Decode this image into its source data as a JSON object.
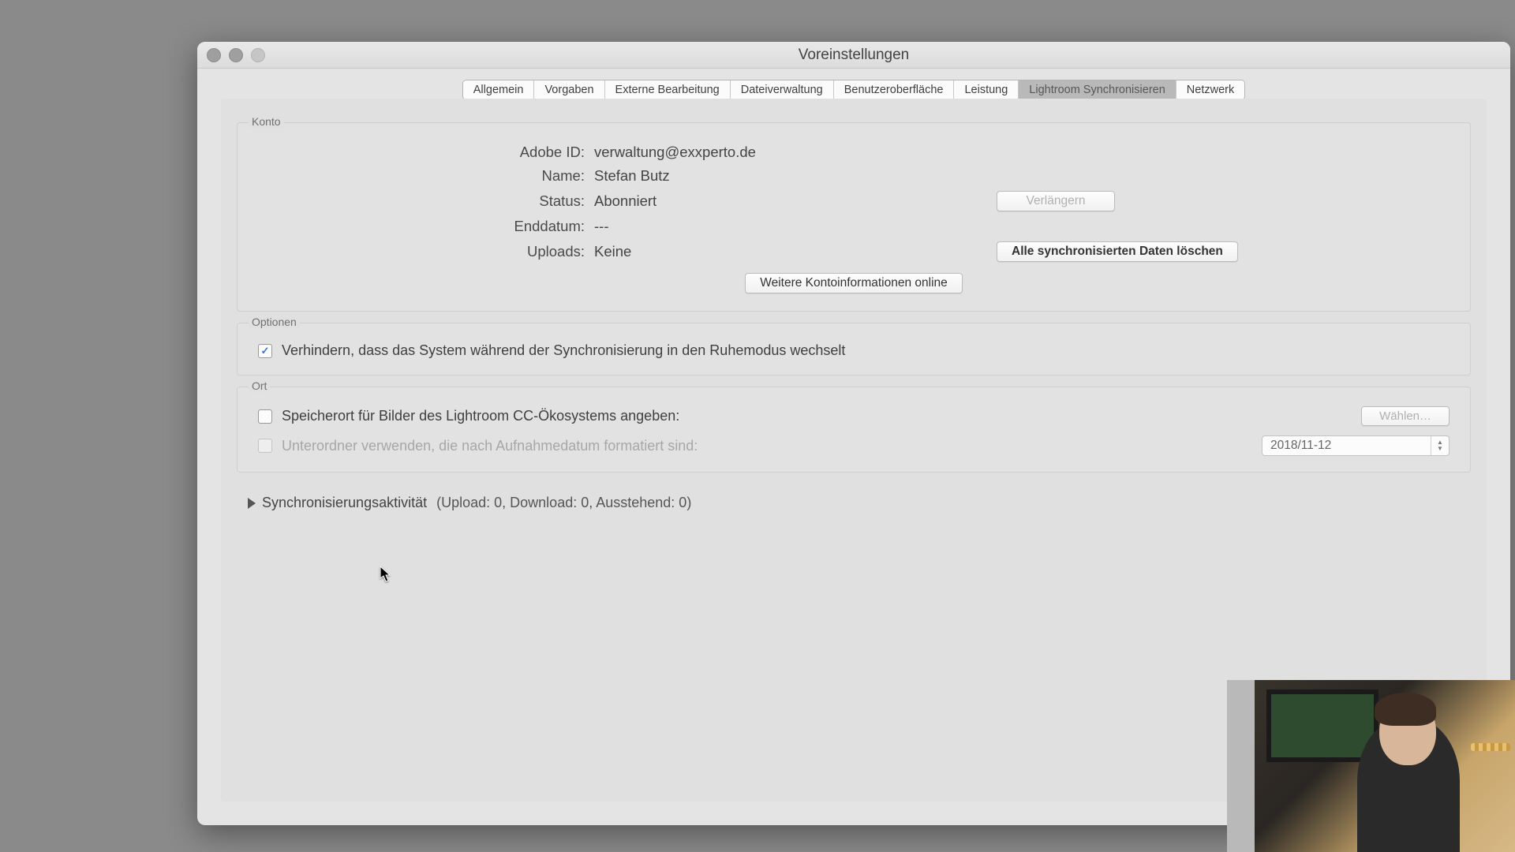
{
  "window": {
    "title": "Voreinstellungen"
  },
  "tabs": [
    {
      "label": "Allgemein"
    },
    {
      "label": "Vorgaben"
    },
    {
      "label": "Externe Bearbeitung"
    },
    {
      "label": "Dateiverwaltung"
    },
    {
      "label": "Benutzeroberfläche"
    },
    {
      "label": "Leistung"
    },
    {
      "label": "Lightroom Synchronisieren"
    },
    {
      "label": "Netzwerk"
    }
  ],
  "konto": {
    "group_label": "Konto",
    "adobe_id_label": "Adobe ID:",
    "adobe_id_value": "verwaltung@exxperto.de",
    "name_label": "Name:",
    "name_value": "Stefan Butz",
    "status_label": "Status:",
    "status_value": "Abonniert",
    "enddatum_label": "Enddatum:",
    "enddatum_value": "---",
    "uploads_label": "Uploads:",
    "uploads_value": "Keine",
    "verlaengern_label": "Verlängern",
    "delete_label": "Alle synchronisierten Daten löschen",
    "more_info_label": "Weitere Kontoinformationen online"
  },
  "optionen": {
    "group_label": "Optionen",
    "prevent_sleep_label": "Verhindern, dass das System während der Synchronisierung in den Ruhemodus wechselt",
    "prevent_sleep_checked": true
  },
  "ort": {
    "group_label": "Ort",
    "specify_location_label": "Speicherort für Bilder des Lightroom CC-Ökosystems angeben:",
    "choose_label": "Wählen…",
    "subfolder_label": "Unterordner verwenden, die nach Aufnahmedatum formatiert sind:",
    "date_preset": "2018/11-12"
  },
  "sync_activity": {
    "label": "Synchronisierungsaktivität",
    "details": "(Upload: 0, Download: 0, Ausstehend: 0)"
  }
}
